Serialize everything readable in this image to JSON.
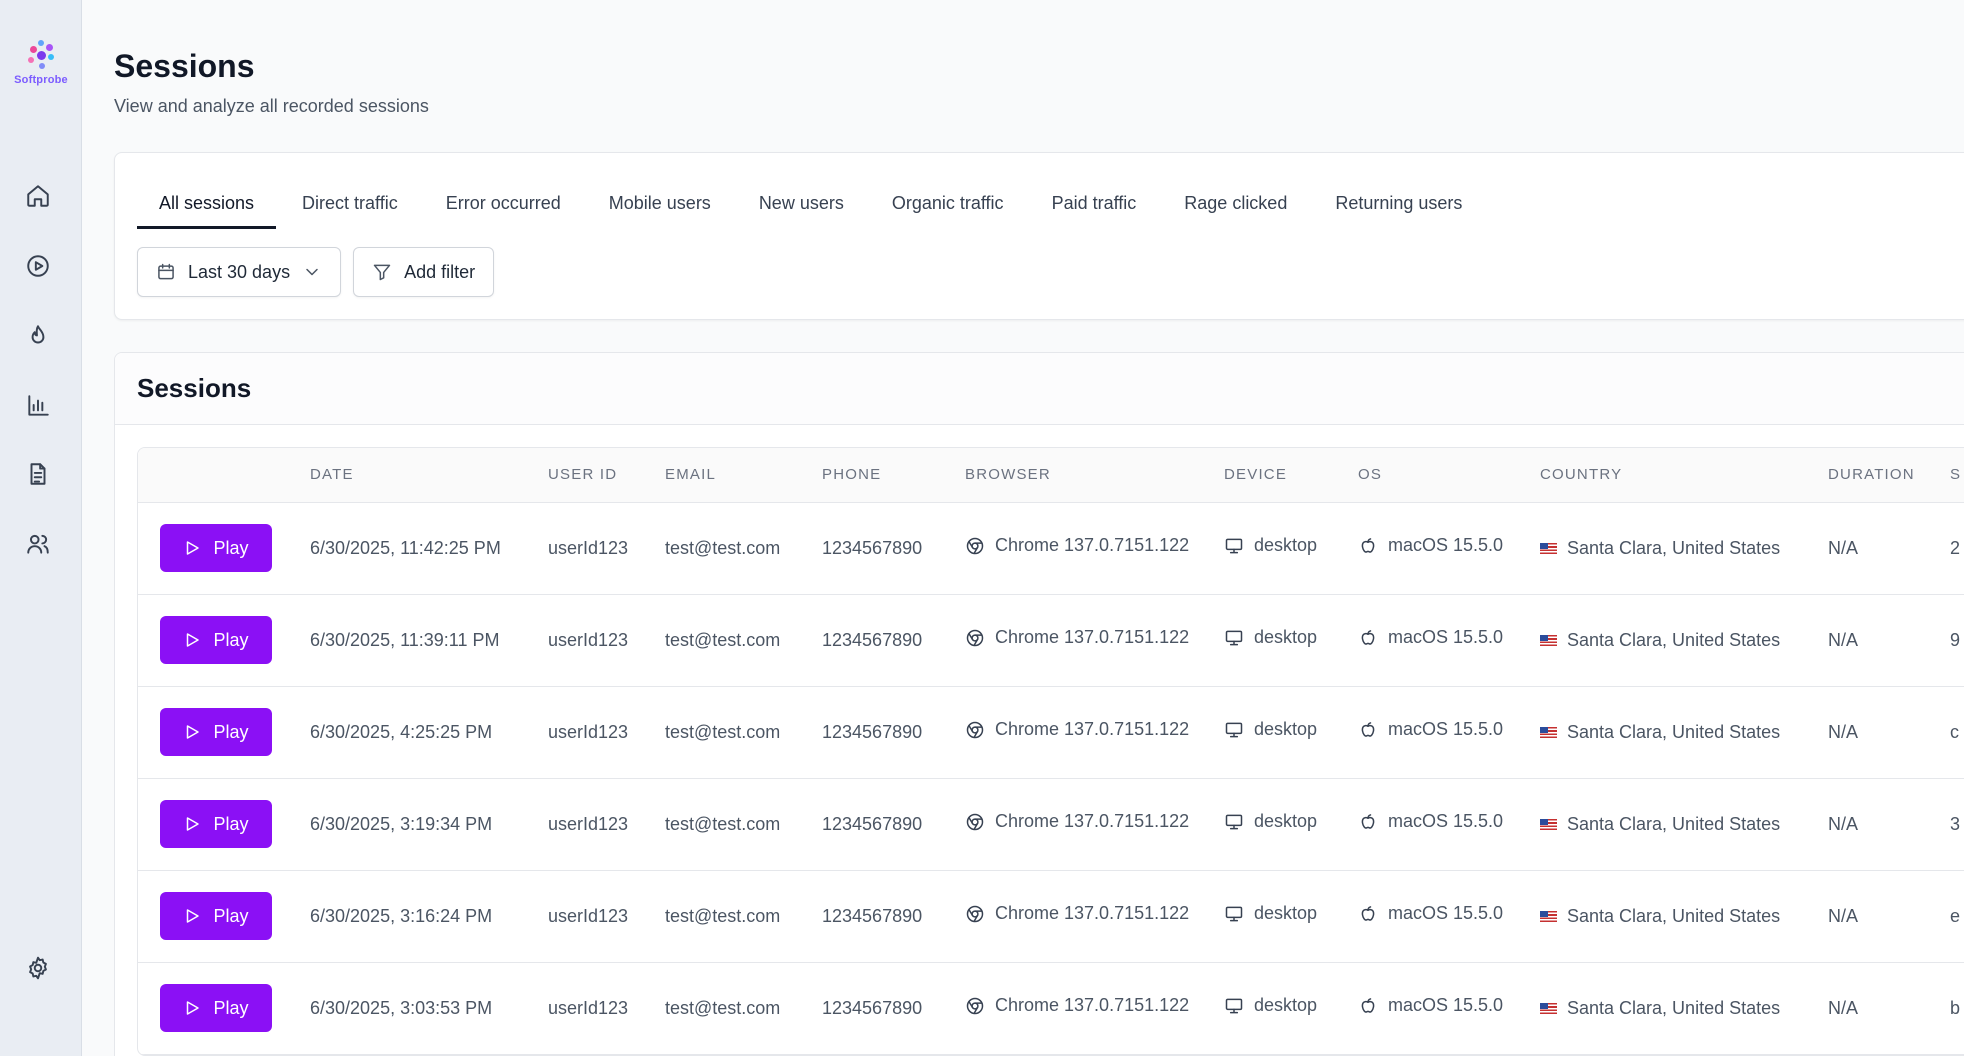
{
  "brand": {
    "name": "Softprobe",
    "accent": "#8b10f5"
  },
  "sidebar": {
    "items": [
      {
        "name": "home",
        "icon": "home-icon"
      },
      {
        "name": "replays",
        "icon": "play-circle-icon"
      },
      {
        "name": "heatmaps",
        "icon": "flame-icon"
      },
      {
        "name": "analytics",
        "icon": "bar-chart-icon"
      },
      {
        "name": "reports",
        "icon": "document-icon"
      },
      {
        "name": "users",
        "icon": "users-icon"
      }
    ],
    "settings_icon": "gear-icon"
  },
  "page": {
    "title": "Sessions",
    "subtitle": "View and analyze all recorded sessions"
  },
  "tabs": [
    {
      "label": "All sessions",
      "active": true
    },
    {
      "label": "Direct traffic"
    },
    {
      "label": "Error occurred"
    },
    {
      "label": "Mobile users"
    },
    {
      "label": "New users"
    },
    {
      "label": "Organic traffic"
    },
    {
      "label": "Paid traffic"
    },
    {
      "label": "Rage clicked"
    },
    {
      "label": "Returning users"
    }
  ],
  "filters": {
    "date_range": "Last 30 days",
    "add_filter": "Add filter"
  },
  "sessions_card": {
    "title": "Sessions",
    "columns": [
      "",
      "DATE",
      "USER ID",
      "EMAIL",
      "PHONE",
      "BROWSER",
      "DEVICE",
      "OS",
      "COUNTRY",
      "DURATION",
      "S"
    ],
    "play_label": "Play",
    "rows": [
      {
        "date": "6/30/2025, 11:42:25 PM",
        "user_id": "userId123",
        "email": "test@test.com",
        "phone": "1234567890",
        "browser": "Chrome 137.0.7151.122",
        "device": "desktop",
        "os": "macOS 15.5.0",
        "country": "Santa Clara, United States",
        "duration": "N/A",
        "extra": "2"
      },
      {
        "date": "6/30/2025, 11:39:11 PM",
        "user_id": "userId123",
        "email": "test@test.com",
        "phone": "1234567890",
        "browser": "Chrome 137.0.7151.122",
        "device": "desktop",
        "os": "macOS 15.5.0",
        "country": "Santa Clara, United States",
        "duration": "N/A",
        "extra": "9"
      },
      {
        "date": "6/30/2025, 4:25:25 PM",
        "user_id": "userId123",
        "email": "test@test.com",
        "phone": "1234567890",
        "browser": "Chrome 137.0.7151.122",
        "device": "desktop",
        "os": "macOS 15.5.0",
        "country": "Santa Clara, United States",
        "duration": "N/A",
        "extra": "c"
      },
      {
        "date": "6/30/2025, 3:19:34 PM",
        "user_id": "userId123",
        "email": "test@test.com",
        "phone": "1234567890",
        "browser": "Chrome 137.0.7151.122",
        "device": "desktop",
        "os": "macOS 15.5.0",
        "country": "Santa Clara, United States",
        "duration": "N/A",
        "extra": "3"
      },
      {
        "date": "6/30/2025, 3:16:24 PM",
        "user_id": "userId123",
        "email": "test@test.com",
        "phone": "1234567890",
        "browser": "Chrome 137.0.7151.122",
        "device": "desktop",
        "os": "macOS 15.5.0",
        "country": "Santa Clara, United States",
        "duration": "N/A",
        "extra": "e"
      },
      {
        "date": "6/30/2025, 3:03:53 PM",
        "user_id": "userId123",
        "email": "test@test.com",
        "phone": "1234567890",
        "browser": "Chrome 137.0.7151.122",
        "device": "desktop",
        "os": "macOS 15.5.0",
        "country": "Santa Clara, United States",
        "duration": "N/A",
        "extra": "b"
      }
    ]
  }
}
